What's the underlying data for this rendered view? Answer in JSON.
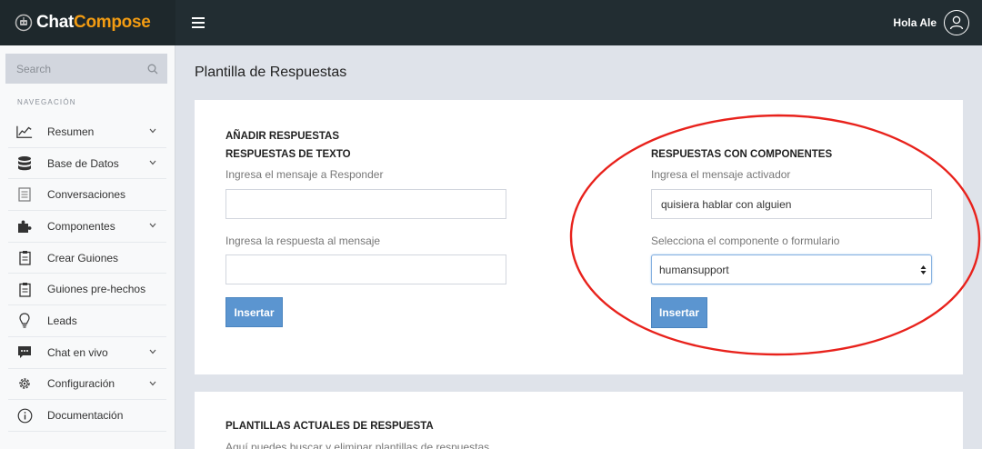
{
  "brand": {
    "part1": "Chat",
    "part2": "Compose"
  },
  "header": {
    "greeting": "Hola Ale"
  },
  "sidebar": {
    "search_placeholder": "Search",
    "nav_header": "NAVEGACIÓN",
    "items": [
      {
        "label": "Resumen",
        "icon": "chart-line-icon",
        "has_chevron": true
      },
      {
        "label": "Base de Datos",
        "icon": "database-icon",
        "has_chevron": true
      },
      {
        "label": "Conversaciones",
        "icon": "list-icon",
        "has_chevron": false
      },
      {
        "label": "Componentes",
        "icon": "puzzle-icon",
        "has_chevron": true
      },
      {
        "label": "Crear Guiones",
        "icon": "clipboard-icon",
        "has_chevron": false
      },
      {
        "label": "Guiones pre-hechos",
        "icon": "clipboard-icon",
        "has_chevron": false
      },
      {
        "label": "Leads",
        "icon": "lightbulb-icon",
        "has_chevron": false
      },
      {
        "label": "Chat en vivo",
        "icon": "chat-bubble-icon",
        "has_chevron": true
      },
      {
        "label": "Configuración",
        "icon": "gear-icon",
        "has_chevron": true
      },
      {
        "label": "Documentación",
        "icon": "info-icon",
        "has_chevron": false
      }
    ]
  },
  "main": {
    "title": "Plantilla de Respuestas",
    "add_section": {
      "heading": "AÑADIR RESPUESTAS",
      "text_responses": {
        "heading": "RESPUESTAS DE TEXTO",
        "message_label": "Ingresa el mensaje a Responder",
        "message_value": "",
        "response_label": "Ingresa la respuesta al mensaje",
        "response_value": "",
        "insert_button": "Insertar"
      },
      "component_responses": {
        "heading": "RESPUESTAS CON COMPONENTES",
        "trigger_label": "Ingresa el mensaje activador",
        "trigger_value": "quisiera hablar con alguien",
        "select_label": "Selecciona el componente o formulario",
        "select_value": "humansupport",
        "insert_button": "Insertar"
      }
    },
    "current_templates": {
      "heading": "PLANTILLAS ACTUALES DE RESPUESTA",
      "description": "Aquí puedes buscar y eliminar plantillas de respuestas"
    }
  },
  "colors": {
    "topbar": "#222d32",
    "brand_bg": "#1e282c",
    "brand_accent": "#f39c12",
    "button": "#5b95d0",
    "annotation": "#e8221c"
  }
}
